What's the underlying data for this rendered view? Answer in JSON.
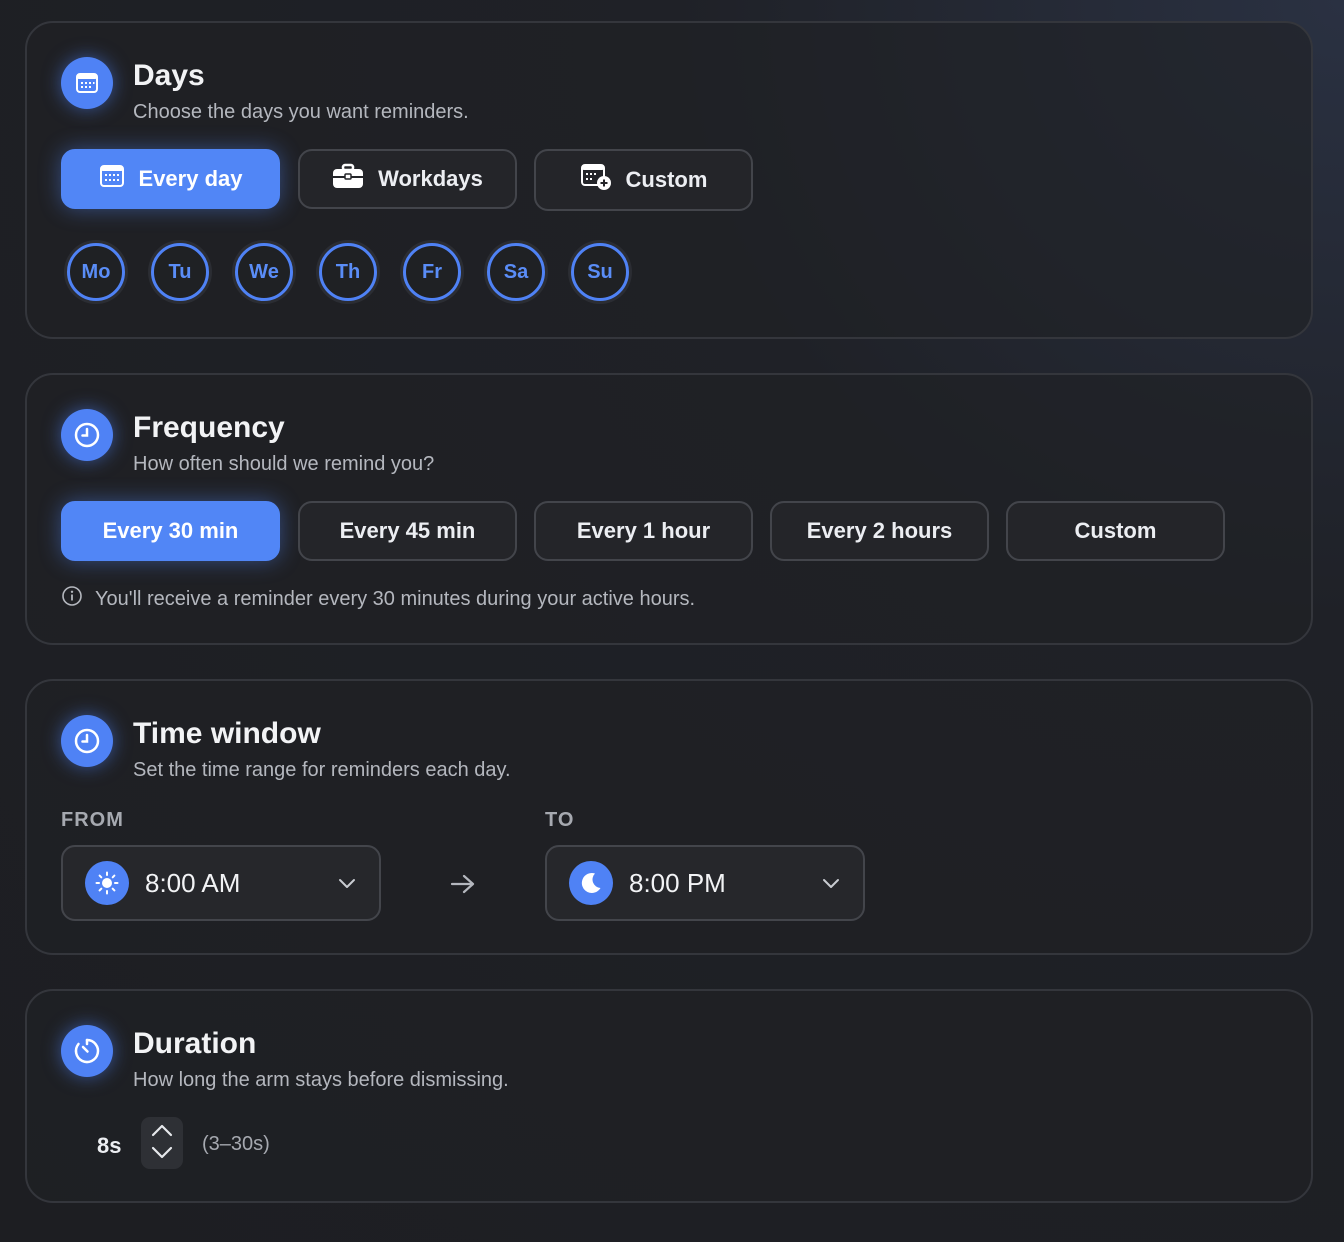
{
  "accent_color": "#4f82f5",
  "days": {
    "title": "Days",
    "subtitle": "Choose the days you want reminders.",
    "icon": "calendar-icon",
    "options": [
      {
        "label": "Every day",
        "icon": "calendar-icon",
        "active": true
      },
      {
        "label": "Workdays",
        "icon": "briefcase-icon",
        "active": false
      },
      {
        "label": "Custom",
        "icon": "calendar-plus-icon",
        "active": false
      }
    ],
    "weekdays": [
      "Mo",
      "Tu",
      "We",
      "Th",
      "Fr",
      "Sa",
      "Su"
    ]
  },
  "frequency": {
    "title": "Frequency",
    "subtitle": "How often should we remind you?",
    "icon": "clock-icon",
    "options": [
      {
        "label": "Every 30 min",
        "active": true
      },
      {
        "label": "Every 45 min",
        "active": false
      },
      {
        "label": "Every 1 hour",
        "active": false
      },
      {
        "label": "Every 2 hours",
        "active": false
      },
      {
        "label": "Custom",
        "active": false
      }
    ],
    "info": "You'll receive a reminder every 30 minutes during your active hours."
  },
  "time_window": {
    "title": "Time window",
    "subtitle": "Set the time range for reminders each day.",
    "icon": "clock-icon",
    "from_label": "FROM",
    "from_value": "8:00 AM",
    "from_icon": "sun-icon",
    "to_label": "TO",
    "to_value": "8:00 PM",
    "to_icon": "moon-icon"
  },
  "duration": {
    "title": "Duration",
    "subtitle": "How long the arm stays before dismissing.",
    "icon": "timer-icon",
    "value": "8s",
    "range": "(3–30s)"
  }
}
